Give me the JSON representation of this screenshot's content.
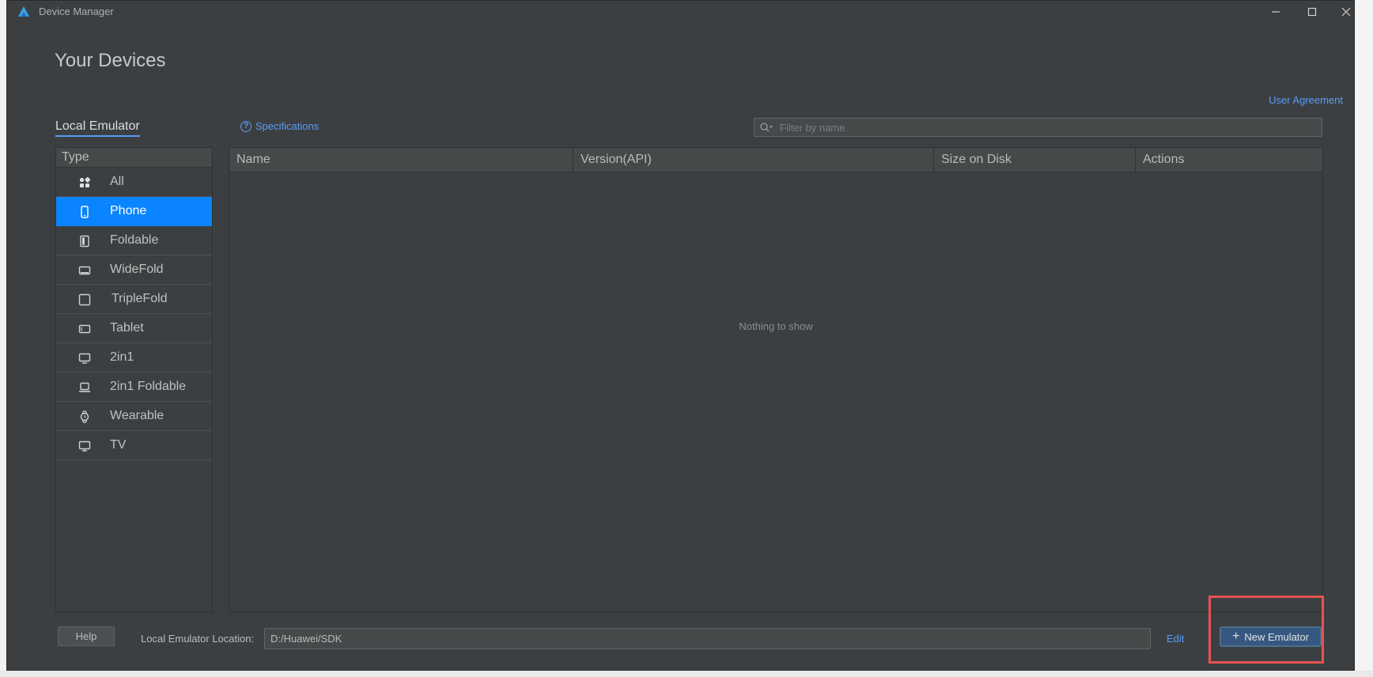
{
  "window": {
    "title": "Device Manager",
    "min_glyph": "—",
    "max_glyph": "☐",
    "close_glyph": "✕"
  },
  "page": {
    "heading": "Your Devices",
    "user_agreement": "User Agreement",
    "tab_local": "Local Emulator",
    "specifications": "Specifications",
    "filter_placeholder": "Filter by name"
  },
  "types": {
    "header": "Type",
    "items": [
      {
        "label": "All",
        "icon": "grid-icon"
      },
      {
        "label": "Phone",
        "icon": "phone-icon"
      },
      {
        "label": "Foldable",
        "icon": "foldable-icon"
      },
      {
        "label": "WideFold",
        "icon": "widefold-icon"
      },
      {
        "label": "TripleFold",
        "icon": "triplefold-icon"
      },
      {
        "label": "Tablet",
        "icon": "tablet-icon"
      },
      {
        "label": "2in1",
        "icon": "monitor-icon"
      },
      {
        "label": "2in1 Foldable",
        "icon": "laptop-icon"
      },
      {
        "label": "Wearable",
        "icon": "watch-icon"
      },
      {
        "label": "TV",
        "icon": "tv-icon"
      }
    ],
    "selected": "Phone"
  },
  "table": {
    "columns": [
      "Name",
      "Version(API)",
      "Size on Disk",
      "Actions"
    ],
    "empty_text": "Nothing to show"
  },
  "footer": {
    "help_label": "Help",
    "location_label": "Local Emulator Location:",
    "location_value": "D:/Huawei/SDK",
    "edit_label": "Edit",
    "new_emulator_label": "New Emulator",
    "new_emulator_glyph": "+"
  },
  "colors": {
    "window_bg": "#3c3f41",
    "accent": "#589df6",
    "selection": "#0a84ff",
    "highlight": "#e8524f"
  }
}
